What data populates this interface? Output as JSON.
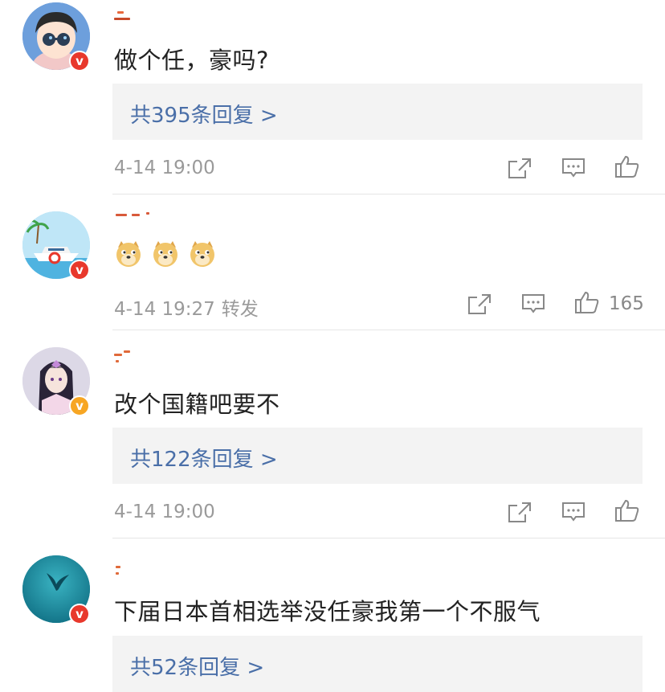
{
  "comments": [
    {
      "text": "做个任，豪吗?",
      "replies": "共395条回复 >",
      "time": "4-14 19:00",
      "forward": "",
      "likes": "",
      "badge": "red",
      "avatar_icon": "cartoon-boy-avatar"
    },
    {
      "text": "",
      "replies": "",
      "time": "4-14 19:27",
      "forward": "转发",
      "likes": "165",
      "badge": "red",
      "avatar_icon": "yacht-avatar"
    },
    {
      "text": "改个国籍吧要不",
      "replies": "共122条回复 >",
      "time": "4-14 19:00",
      "forward": "",
      "likes": "",
      "badge": "gold",
      "avatar_icon": "anime-girl-avatar"
    },
    {
      "text": "下届日本首相选举没任豪我第一个不服气",
      "replies": "共52条回复 >",
      "time": "",
      "forward": "",
      "likes": "",
      "badge": "red",
      "avatar_icon": "whale-avatar"
    }
  ],
  "badge_letter": "v",
  "colors": {
    "link": "#4a6fa8",
    "meta": "#9a9a9a",
    "badge_red": "#e8382c",
    "badge_gold": "#f7a623"
  }
}
